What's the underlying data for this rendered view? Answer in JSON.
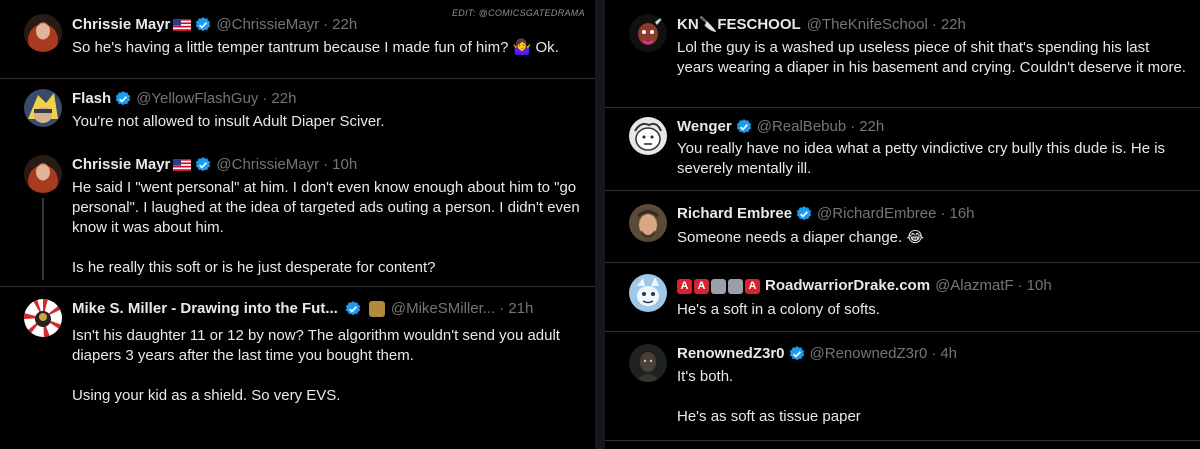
{
  "watermark": "EDIT: @COMICSGATEDRAMA",
  "left": [
    {
      "name": "Chrissie Mayr",
      "handle": "@ChrissieMayr",
      "time": "22h",
      "text": [
        "So he's having a little temper tantrum because I made fun of him? 🤷‍♀️ Ok."
      ]
    },
    {
      "name": "Flash",
      "handle": "@YellowFlashGuy",
      "time": "22h",
      "text": [
        "You're not allowed to insult Adult Diaper Sciver."
      ]
    },
    {
      "name": "Chrissie Mayr",
      "handle": "@ChrissieMayr",
      "time": "10h",
      "text": [
        "He said I \"went personal\" at him. I don't even know enough about him to \"go personal\". I laughed at the idea of targeted ads outing a person. I didn't even know it was about him.",
        "Is he really this soft or is he just desperate for content?"
      ]
    },
    {
      "name": "Mike S. Miller - Drawing into the Fut...",
      "handle": "@MikeSMiller...",
      "time": "21h",
      "text": [
        "Isn't his daughter 11 or 12 by now? The algorithm wouldn't send you adult diapers 3 years after the last time you bought them.",
        "Using your kid as a shield. So very EVS."
      ]
    }
  ],
  "right": [
    {
      "name": "KN🔪FESCHOOL",
      "handle": "@TheKnifeSchool",
      "time": "22h",
      "text": [
        "Lol the guy is a washed up useless piece of shit that's spending his last years wearing a diaper in his basement and crying. Couldn't deserve it more."
      ]
    },
    {
      "name": "Wenger",
      "handle": "@RealBebub",
      "time": "22h",
      "text": [
        "You really have no idea what a petty vindictive cry bully this dude is. He is severely mentally ill."
      ]
    },
    {
      "name": "Richard Embree",
      "handle": "@RichardEmbree",
      "time": "16h",
      "text": [
        "Someone needs a diaper change. 😂"
      ]
    },
    {
      "name_badges": [
        "A",
        "A",
        "",
        "",
        "A"
      ],
      "name": "RoadwarriorDrake.com",
      "handle": "@AlazmatF",
      "time": "10h",
      "text": [
        "He's a soft in a colony of softs."
      ]
    },
    {
      "name": "RenownedZ3r0",
      "handle": "@RenownedZ3r0",
      "time": "4h",
      "text": [
        "It's both.",
        "He's as soft as tissue paper"
      ]
    }
  ],
  "colors": {
    "background": "#000000",
    "text": "#e7e9ea",
    "muted": "#71767b",
    "verified": "#1d9bf0",
    "separator": "#2f3336"
  }
}
